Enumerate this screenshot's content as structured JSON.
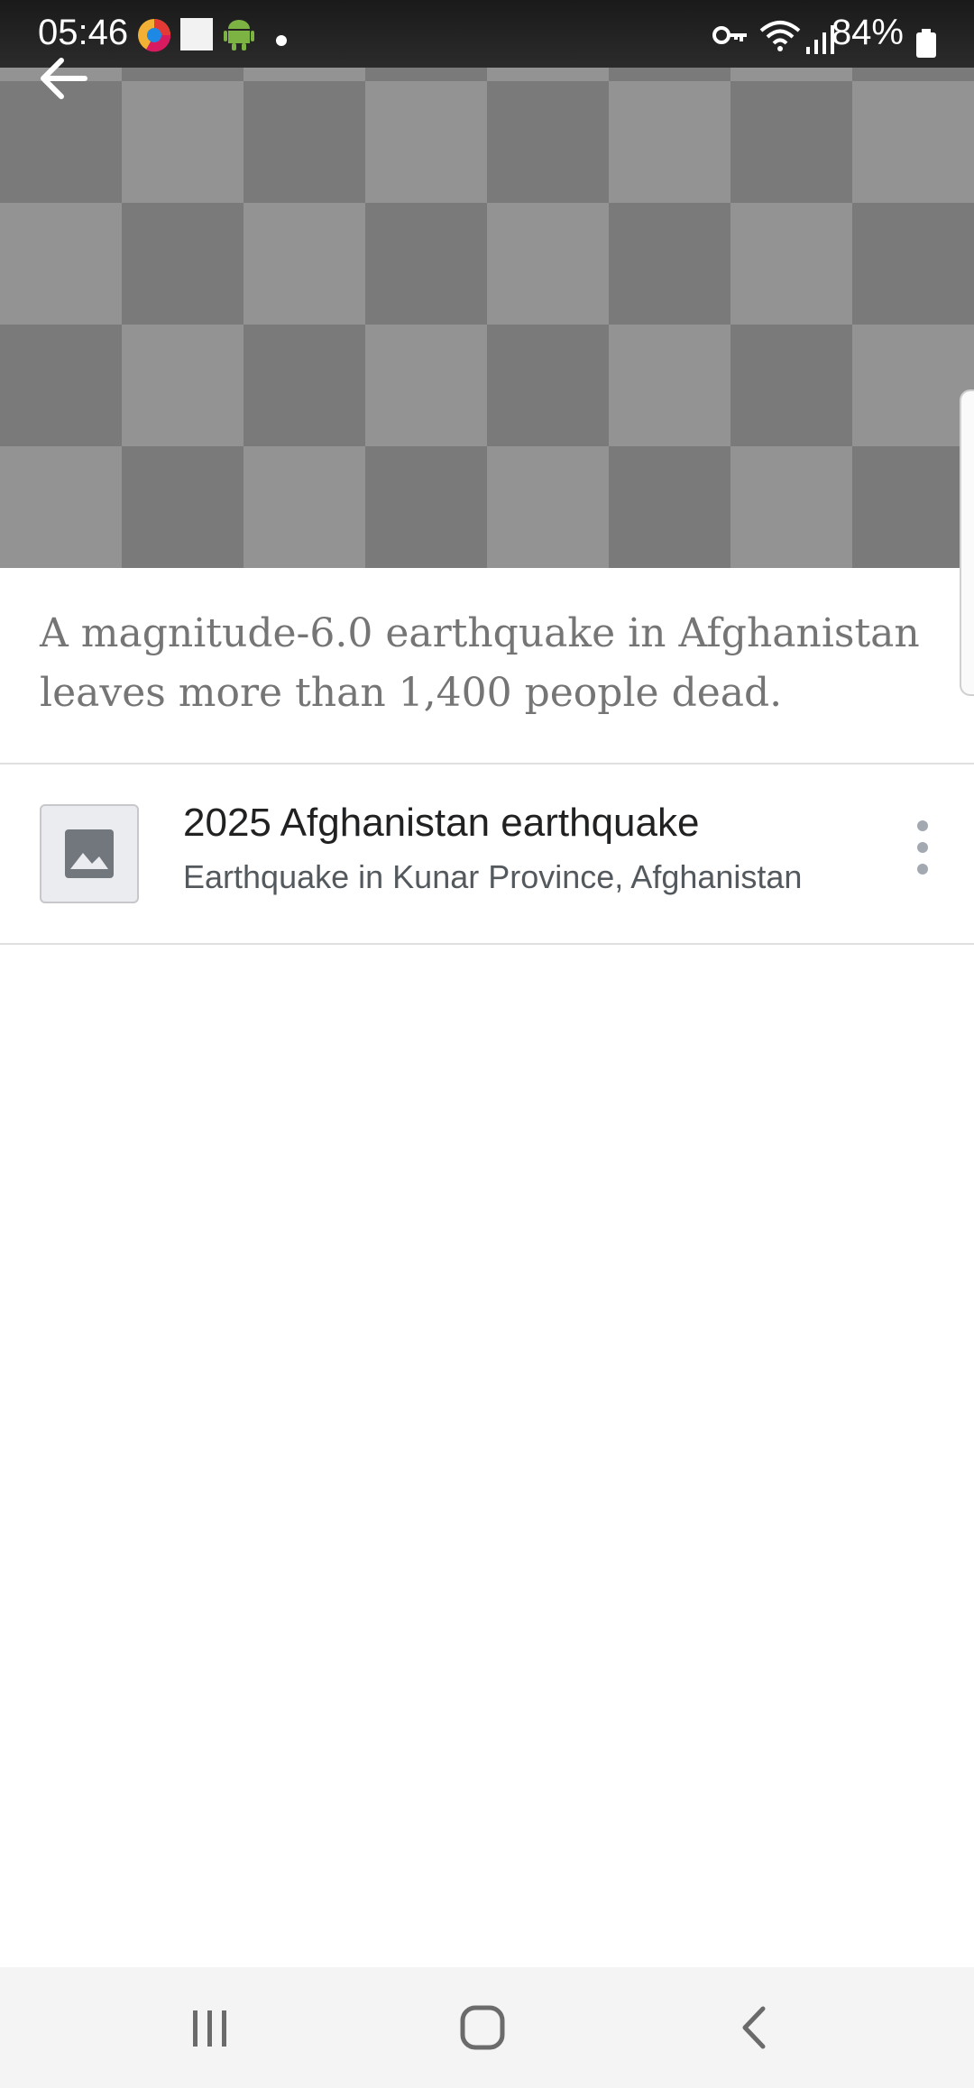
{
  "status_bar": {
    "time": "05:46",
    "battery": "84%",
    "icons": [
      "chrome-like-app-icon",
      "white-square-icon",
      "android-icon",
      "dot-icon",
      "vpn-key-icon",
      "wifi-icon",
      "signal-icon",
      "battery-icon"
    ]
  },
  "header": {
    "back_icon": "arrow-left-icon"
  },
  "description": "A magnitude-6.0 earthquake in Afghanistan leaves more than 1,400 people dead.",
  "article": {
    "title": "2025 Afghanistan earthquake",
    "subtitle": "Earthquake in Kunar Province, Afghanistan",
    "thumb_icon": "image-icon",
    "menu_icon": "more-vertical-icon"
  },
  "nav": {
    "icons": [
      "recent-apps-icon",
      "home-icon",
      "back-icon"
    ]
  },
  "colors": {
    "checker_light": "#939393",
    "checker_dark": "#7a7a7a",
    "description_text": "#757575",
    "title_text": "#202122"
  }
}
